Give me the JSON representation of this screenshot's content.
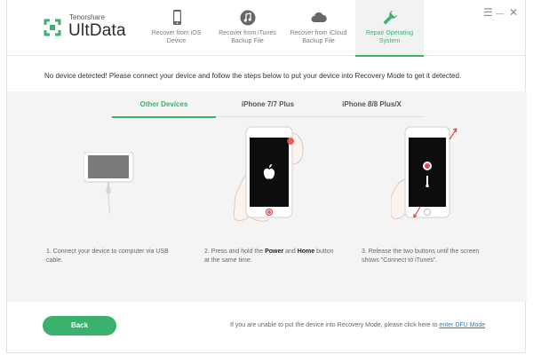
{
  "brand": {
    "small": "Tenorshare",
    "big": "UltData"
  },
  "nav": [
    {
      "label": "Recover from iOS Device",
      "icon": "phone-icon"
    },
    {
      "label": "Recover from iTunes Backup File",
      "icon": "music-note-icon"
    },
    {
      "label": "Recover from iCloud Backup File",
      "icon": "cloud-icon"
    },
    {
      "label": "Repair Operating System",
      "icon": "wrench-icon"
    }
  ],
  "window_controls": {
    "menu": "☰",
    "minimize": "—",
    "close": "✕"
  },
  "message": "No device detected! Please connect your device and follow the steps below to put your device into Recovery Mode to get it detected.",
  "tabs": [
    {
      "label": "Other Devices"
    },
    {
      "label": "iPhone 7/7 Plus"
    },
    {
      "label": "iPhone 8/8 Plus/X"
    }
  ],
  "steps": {
    "one": "1. Connect your device to computer via USB cable.",
    "two_prefix": "2. Press and hold the ",
    "two_power": "Power",
    "two_and": " and ",
    "two_home": "Home",
    "two_suffix": " button at the same time.",
    "three": "3. Release the two buttons until the screen shows \"Connect to iTunes\"."
  },
  "footer": {
    "back_label": "Back",
    "note": "If you are unable to put the device into Recovery Mode, please click here to ",
    "link": "enter DFU Mode"
  },
  "colors": {
    "accent": "#3bb16e",
    "link": "#1e7fd6"
  }
}
